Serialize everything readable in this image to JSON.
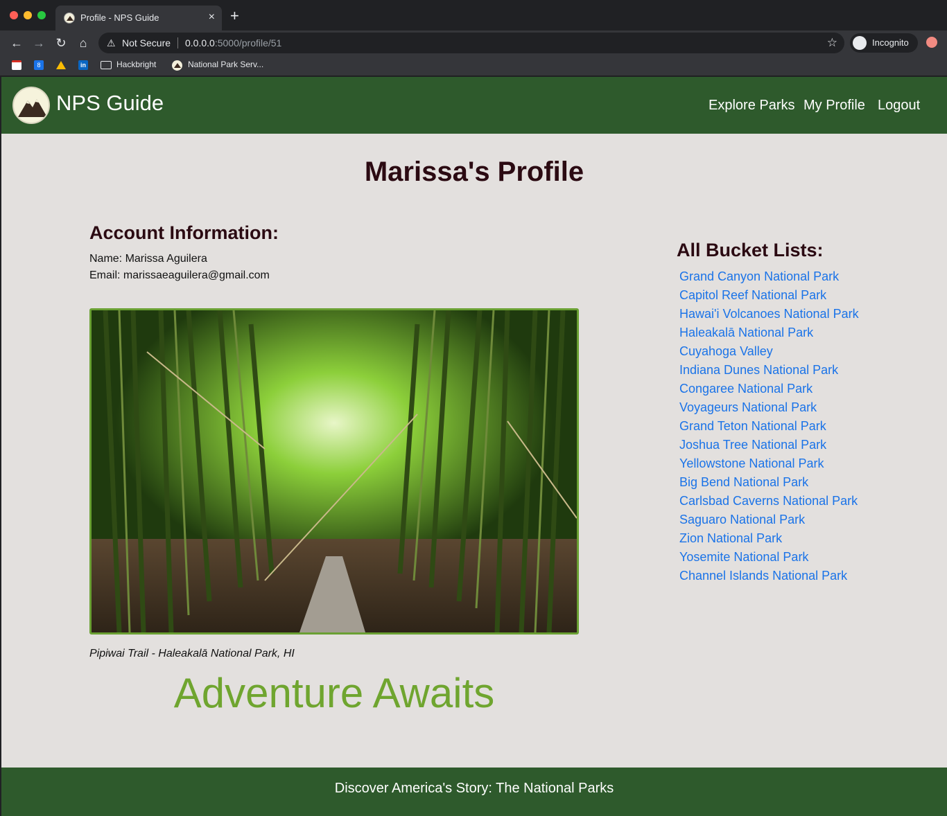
{
  "browser": {
    "tab_title": "Profile - NPS Guide",
    "tab_close": "×",
    "new_tab": "+",
    "nav": {
      "back": "←",
      "forward": "→",
      "reload": "↻",
      "home": "⌂"
    },
    "security_icon": "⚠",
    "security_text": "Not Secure",
    "url_host": "0.0.0.0",
    "url_rest": ":5000/profile/51",
    "star": "☆",
    "profile_label": "Incognito",
    "bookmarks": [
      {
        "label": "Hackbright",
        "icon": "folder-icon"
      },
      {
        "label": "National Park Serv...",
        "icon": "nps-favicon"
      }
    ],
    "bookmark_calendar_text": "8",
    "bookmark_linkedin_text": "in"
  },
  "site": {
    "brand": "NPS Guide",
    "nav_links": [
      "Explore Parks",
      "My Profile",
      "Logout"
    ],
    "title": "Marissa's Profile",
    "account_heading": "Account Information:",
    "name_line": "Name: Marissa Aguilera",
    "email_line": "Email: marissaeaguilera@gmail.com",
    "photo_caption": "Pipiwai Trail - Haleakalā National Park, HI",
    "tagline": "Adventure Awaits",
    "bucket_heading": "All Bucket Lists:",
    "bucket_lists": [
      "Grand Canyon National Park",
      "Capitol Reef National Park",
      "Hawai'i Volcanoes National Park",
      "Haleakalā National Park",
      "Cuyahoga Valley",
      "Indiana Dunes National Park",
      "Congaree National Park",
      "Voyageurs National Park",
      "Grand Teton National Park",
      "Joshua Tree National Park",
      "Yellowstone National Park",
      "Big Bend National Park",
      "Carlsbad Caverns National Park",
      "Saguaro National Park",
      "Zion National Park",
      "Yosemite National Park",
      "Channel Islands National Park"
    ],
    "footer": "Discover America's Story: The National Parks"
  },
  "colors": {
    "nav_green": "#2e5a2c",
    "page_bg": "#e3e0de",
    "link_blue": "#1a73e8",
    "accent_green": "#6fa52f",
    "heading": "#2b0a12"
  }
}
